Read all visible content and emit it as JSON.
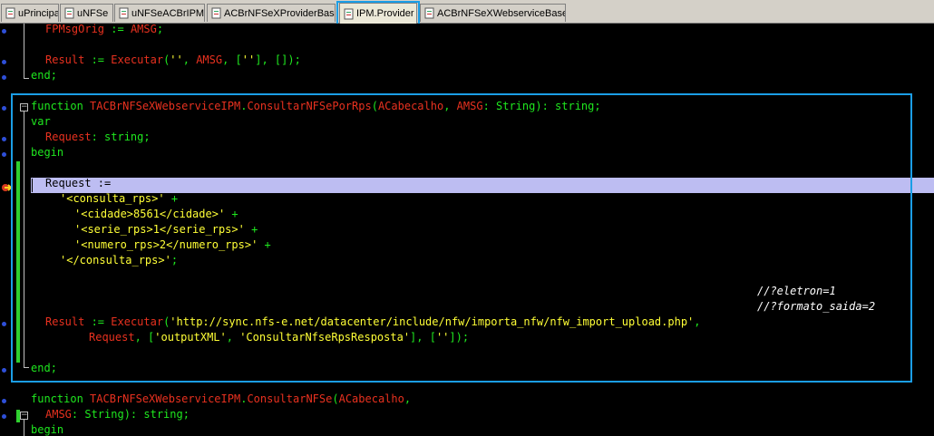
{
  "tabs": [
    {
      "label": "uPrincipal",
      "icon": "unit-file-icon"
    },
    {
      "label": "uNFSe",
      "icon": "unit-file-icon"
    },
    {
      "label": "uNFSeACBrIPM",
      "icon": "unit-file-icon"
    },
    {
      "label": "ACBrNFSeXProviderBase",
      "icon": "unit-file-icon"
    },
    {
      "label": "IPM.Provider",
      "icon": "unit-file-icon",
      "active": true
    },
    {
      "label": "ACBrNFSeXWebserviceBase",
      "icon": "unit-file-icon"
    }
  ],
  "code": {
    "l1": {
      "a": "FPMsgOrig",
      "b": " := ",
      "c": "AMSG",
      "d": ";"
    },
    "l3": {
      "a": "Result",
      "b": " := ",
      "c": "Executar",
      "d": "(",
      "e": "''",
      "f": ", ",
      "g": "AMSG",
      "h": ", [",
      "i": "''",
      "j": "], []);"
    },
    "l4": {
      "a": "end",
      "b": ";"
    },
    "l6": {
      "a": "function ",
      "b": "TACBrNFSeXWebserviceIPM",
      "c": ".",
      "d": "ConsultarNFSePorRps",
      "e": "(",
      "f": "ACabecalho",
      "g": ", ",
      "h": "AMSG",
      "i": ": String): string;"
    },
    "l7": {
      "a": "var"
    },
    "l8": {
      "a": "Request",
      "b": ": string;"
    },
    "l9": {
      "a": "begin"
    },
    "l11": {
      "a": "Request :="
    },
    "l12": {
      "a": "'<consulta_rps>'",
      "b": " +"
    },
    "l13": {
      "a": "'<cidade>8561</cidade>'",
      "b": " +"
    },
    "l14": {
      "a": "'<serie_rps>1</serie_rps>'",
      "b": " +"
    },
    "l15": {
      "a": "'<numero_rps>2</numero_rps>'",
      "b": " +"
    },
    "l16": {
      "a": "'</consulta_rps>'",
      "b": ";"
    },
    "l19": {
      "a": "//?eletron=1"
    },
    "l20": {
      "a": "//?formato_saida=2"
    },
    "l21": {
      "a": "Result",
      "b": " := ",
      "c": "Executar",
      "d": "(",
      "e": "'http://sync.nfs-e.net/datacenter/include/nfw/importa_nfw/nfw_import_upload.php'",
      "f": ","
    },
    "l22": {
      "a": "Request",
      "b": ", [",
      "c": "'outputXML'",
      "d": ", ",
      "e": "'ConsultarNfseRpsResposta'",
      "f": "], [",
      "g": "''",
      "h": "]);"
    },
    "l24": {
      "a": "end",
      "b": ";"
    },
    "l26": {
      "a": "function ",
      "b": "TACBrNFSeXWebserviceIPM",
      "c": ".",
      "d": "ConsultarNFSe",
      "e": "(",
      "f": "ACabecalho",
      "g": ","
    },
    "l27": {
      "a": "AMSG",
      "b": ": String): string;"
    },
    "l28": {
      "a": "begin"
    }
  }
}
